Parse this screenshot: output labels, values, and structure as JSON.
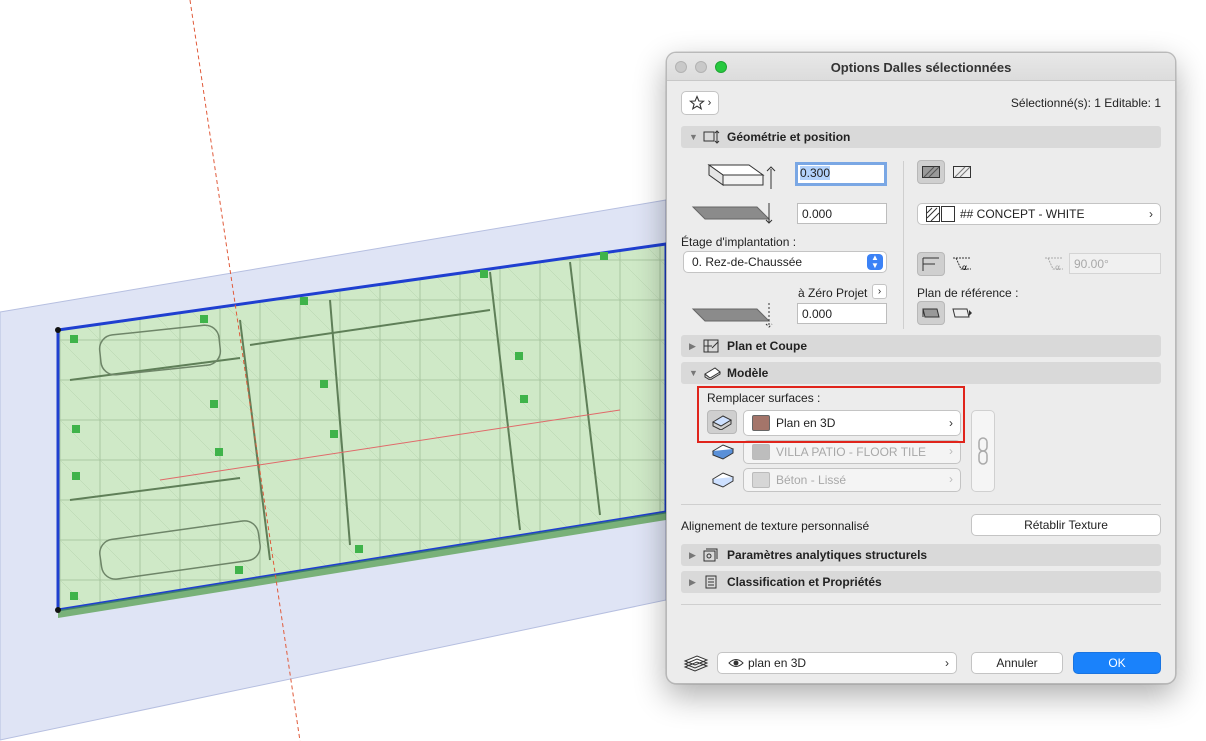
{
  "dialog": {
    "title": "Options Dalles sélectionnées",
    "selection_info": "Sélectionné(s): 1 Editable: 1",
    "favorites_icon": "star-icon"
  },
  "geometry": {
    "section_label": "Géométrie et position",
    "thickness": "0.300",
    "offset": "0.000",
    "story_label": "Étage d'implantation :",
    "story_value": "0. Rez-de-Chaussée",
    "zero_label": "à Zéro Projet",
    "zero_value": "0.000",
    "surface_material": "## CONCEPT - WHITE",
    "angle_value": "90.00°",
    "reference_plane_label": "Plan de référence :"
  },
  "sections": {
    "plan_coupe": "Plan et Coupe",
    "modele": "Modèle",
    "analytics": "Paramètres analytiques structurels",
    "classification": "Classification et Propriétés"
  },
  "model": {
    "override_label": "Remplacer surfaces :",
    "surfaces": [
      {
        "name": "Plan en 3D",
        "color": "#a4756a",
        "enabled": true
      },
      {
        "name": "VILLA PATIO - FLOOR TILE",
        "color": "#bdbdbd",
        "enabled": false
      },
      {
        "name": "Béton - Lissé",
        "color": "#d6d6d6",
        "enabled": false
      }
    ],
    "texture_alignment_label": "Alignement de texture personnalisé",
    "reset_texture_button": "Rétablir Texture"
  },
  "footer": {
    "layer_value": "plan en 3D",
    "cancel_button": "Annuler",
    "ok_button": "OK"
  },
  "colors": {
    "accent": "#1a82fb",
    "highlight": "#e0241b",
    "selection_outline": "#1f3fd0",
    "slab_fill": "#c7e8c1"
  }
}
